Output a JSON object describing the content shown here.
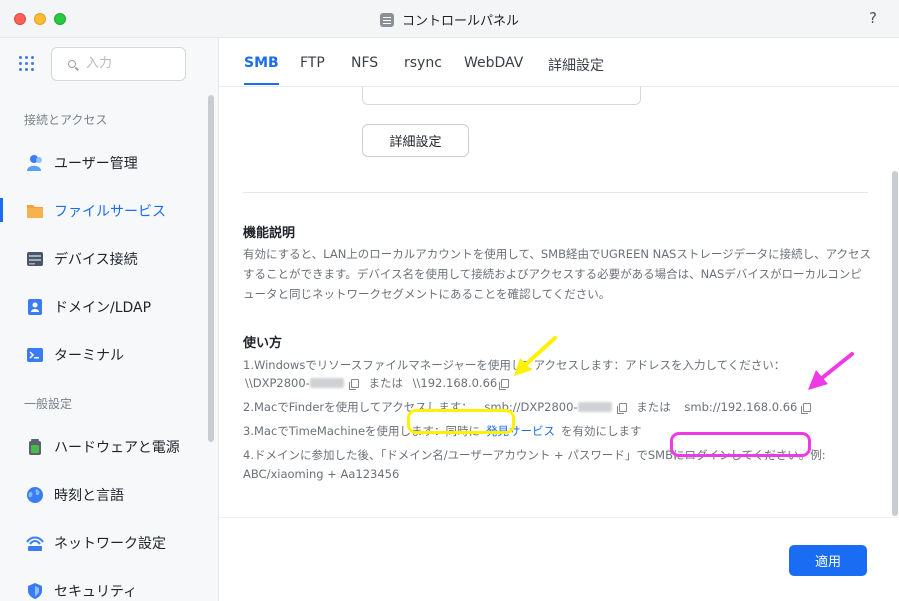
{
  "window": {
    "title": "コントロールパネル",
    "help_label": "?",
    "title_icon": "control-panel-icon"
  },
  "sidebar": {
    "search_placeholder": "入力",
    "sections": [
      {
        "label": "接続とアクセス",
        "items": [
          {
            "label": "ユーザー管理",
            "icon": "users-icon",
            "active": false
          },
          {
            "label": "ファイルサービス",
            "icon": "folder-icon",
            "active": true
          },
          {
            "label": "デバイス接続",
            "icon": "device-icon",
            "active": false
          },
          {
            "label": "ドメイン/LDAP",
            "icon": "domain-icon",
            "active": false
          },
          {
            "label": "ターミナル",
            "icon": "terminal-icon",
            "active": false
          }
        ]
      },
      {
        "label": "一般設定",
        "items": [
          {
            "label": "ハードウェアと電源",
            "icon": "battery-icon",
            "active": false
          },
          {
            "label": "時刻と言語",
            "icon": "globe-icon",
            "active": false
          },
          {
            "label": "ネットワーク設定",
            "icon": "network-icon",
            "active": false
          },
          {
            "label": "セキュリティ",
            "icon": "shield-icon",
            "active": false
          }
        ]
      }
    ]
  },
  "tabs": [
    "SMB",
    "FTP",
    "NFS",
    "rsync",
    "WebDAV",
    "詳細設定"
  ],
  "active_tab": "SMB",
  "main": {
    "detail_button": "詳細設定",
    "feature_title": "機能説明",
    "feature_text": "有効にすると、LAN上のローカルアカウントを使用して、SMB経由でUGREEN NASストレージデータに接続し、アクセスすることができます。デバイス名を使用して接続およびアクセスする必要がある場合は、NASデバイスがローカルコンピュータと同じネットワークセグメントにあることを確認してください。",
    "usage_title": "使い方",
    "usage": {
      "line1": "1.Windowsでリソースファイルマネージャーを使用してアクセスします：アドレスを入力してください：",
      "line1b_prefix": "\\\\DXP2800-",
      "line1b_or": "または",
      "line1b_addr": "\\\\192.168.0.66",
      "line2_prefix": "2.MacでFinderを使用してアクセスします：",
      "line2_addr1": "smb://DXP2800-",
      "line2_or": "または",
      "line2_addr2": "smb://192.168.0.66",
      "line3_prefix": "3.MacでTimeMachineを使用します：同時に",
      "line3_link": "発見サービス",
      "line3_suffix": "を有効にします",
      "line4": "4.ドメインに参加した後、「ドメイン名/ユーザーアカウント + パスワード」でSMBにログインしてください。例:",
      "line4b": "ABC/xiaoming + Aa123456"
    },
    "apply_button": "適用"
  },
  "colors": {
    "accent": "#1a6cf3",
    "highlight_yellow": "#fff200",
    "highlight_pink": "#f039e6"
  }
}
